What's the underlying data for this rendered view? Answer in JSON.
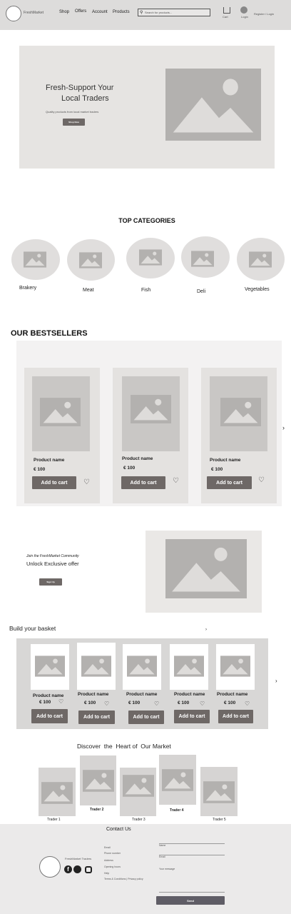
{
  "header": {
    "brand": "FreshMarket",
    "nav": [
      "Shop",
      "Offers",
      "Account",
      "Products"
    ],
    "search_placeholder": "Search for products...",
    "cart_label": "Cart",
    "account_label": "Login",
    "signin_label": "Register / Login"
  },
  "hero": {
    "title_line1": "Fresh-Support Your",
    "title_line2": "Local Traders",
    "subtitle": "Quality products from local market traders",
    "button": "Shop Now"
  },
  "categories": {
    "title": "TOP CATEGORIES",
    "items": [
      "Brakery",
      "Meat",
      "Fish",
      "Deli",
      "Vegetables"
    ]
  },
  "bestsellers": {
    "title": "OUR BESTSELLERS",
    "products": [
      {
        "name": "Product name",
        "price": "€ 100",
        "button": "Add to cart"
      },
      {
        "name": "Product name",
        "price": "€ 100",
        "button": "Add to cart"
      },
      {
        "name": "Product name",
        "price": "€ 100",
        "button": "Add to cart"
      }
    ]
  },
  "promo": {
    "eyebrow": "Join the FreshMarket Community",
    "title": "Unlock Exclusive offer",
    "button": "Sign Up"
  },
  "basket": {
    "title": "Build your basket",
    "products": [
      {
        "name": "Product name",
        "price": "€ 100",
        "button": "Add to cart"
      },
      {
        "name": "Product name",
        "price": "€ 100",
        "button": "Add to cart"
      },
      {
        "name": "Product name",
        "price": "€ 100",
        "button": "Add to cart"
      },
      {
        "name": "Product name",
        "price": "€ 100",
        "button": "Add to cart"
      },
      {
        "name": "Product name",
        "price": "€ 100",
        "button": "Add to cart"
      }
    ]
  },
  "traders": {
    "title": "Discover  the  Heart of  Our Market",
    "items": [
      "Trader 1",
      "Trader 2",
      "Trader 3",
      "Trader 4",
      "Trader 5"
    ]
  },
  "footer": {
    "title": "Contact Us",
    "brand": "FreshMarket Traders",
    "links": [
      "Email",
      "Phone number",
      "Address",
      "Opening hours",
      "Help",
      "Terms & Conditions | Privacy policy"
    ],
    "form_fields": [
      "Name",
      "Email",
      "Your message"
    ],
    "submit": "Send"
  }
}
